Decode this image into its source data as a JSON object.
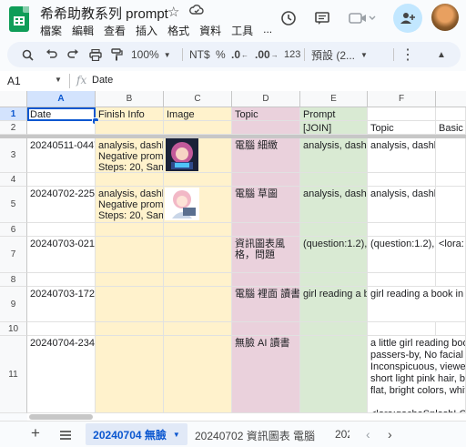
{
  "app": {
    "doc_title": "希希助教系列 prompt",
    "menu": [
      "檔案",
      "編輯",
      "查看",
      "插入",
      "格式",
      "資料",
      "工具",
      "..."
    ]
  },
  "toolbar": {
    "zoom": "100%",
    "currency": "NT$",
    "percent": "%",
    "dec_decrease": ".0",
    "dec_increase": ".00",
    "number_format": "123",
    "font": "預設 (2..."
  },
  "formula_bar": {
    "name_box": "A1",
    "fx": "fx",
    "content": "Date"
  },
  "sheet": {
    "columns": [
      "A",
      "B",
      "C",
      "D",
      "E",
      "F"
    ],
    "rows": [
      {
        "num": "1",
        "cells": [
          "Date",
          "Finish Info",
          "Image",
          "Topic",
          "Prompt",
          ""
        ]
      },
      {
        "num": "2",
        "cells": [
          "",
          "",
          "",
          "",
          "[JOIN]",
          "Topic"
        ],
        "extra": "Basic"
      },
      {
        "num": "3",
        "cells": [
          "20240511-0447",
          "analysis, dashboard, computer\nNegative prompt: ...\nSteps: 20, Sampler: ...",
          "",
          "電腦 細緻",
          "analysis, dashboard, computer",
          "analysis, dashboard, computer"
        ]
      },
      {
        "num": "4",
        "cells": [
          "",
          "",
          "",
          "",
          "",
          ""
        ]
      },
      {
        "num": "5",
        "cells": [
          "20240702-2250",
          "analysis, dashboard, computer\nNegative prompt: ...\nSteps: 20, Sampler: ...",
          "",
          "電腦 草圖",
          "analysis, dashboard, computer",
          "analysis, dashboard, computer"
        ]
      },
      {
        "num": "6",
        "cells": [
          "",
          "",
          "",
          "",
          "",
          ""
        ]
      },
      {
        "num": "7",
        "cells": [
          "20240703-0218",
          "",
          "",
          "資訊圖表風格，問題",
          "(question:1.2), question",
          "(question:1.2), question"
        ],
        "extra": "<lora:"
      },
      {
        "num": "8",
        "cells": [
          "",
          "",
          "",
          "",
          "",
          ""
        ]
      },
      {
        "num": "9",
        "cells": [
          "20240703-1720",
          "",
          "",
          "電腦 裡面 讀書",
          "girl reading a book in",
          "girl reading a book in d"
        ]
      },
      {
        "num": "10",
        "cells": [
          "",
          "",
          "",
          "",
          "",
          ""
        ]
      },
      {
        "num": "11",
        "cells": [
          "20240704-2345",
          "",
          "",
          "無臉 AI 讀書",
          "",
          "a little girl reading book\npassers-by, No facial fe\nInconspicuous, viewer f\nshort light pink hair, bar\nflat, bright colors, white\n\n<lora:gachaSplashLOR"
        ]
      }
    ]
  },
  "sheet_tabs": {
    "tabs": [
      "20240704 無臉",
      "20240702 資訊圖表 電腦",
      "202"
    ],
    "active_index": 0
  },
  "colors": {
    "accent": "#0b57d0",
    "yellow_fill": "#fff2cc",
    "pink_fill": "#ead1dc",
    "green_fill": "#d9ead3"
  }
}
